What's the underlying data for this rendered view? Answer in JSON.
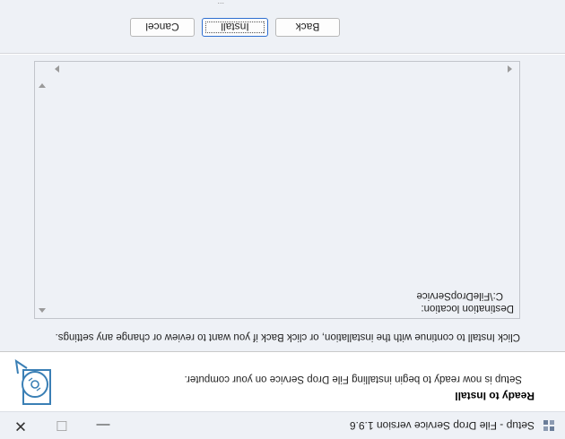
{
  "window": {
    "title": "Setup - File Drop Service version 1.9.6",
    "minimize_label": "—",
    "maximize_label": "☐",
    "close_label": "✕"
  },
  "header": {
    "title": "Ready to Install",
    "subtitle": "Setup is now ready to begin installing File Drop Service on your computer.",
    "icon": "setup-disc-icon"
  },
  "body": {
    "instruction": "Click Install to continue with the installation, or click Back if you want to review or change any settings.",
    "memo": {
      "heading": "Destination location:",
      "value": "C:\\FileDropService"
    }
  },
  "footer": {
    "back_label": "Back",
    "install_label": "Install",
    "cancel_label": "Cancel",
    "fragment": "..."
  },
  "colors": {
    "body_bg": "#eef1f6",
    "header_bg": "#ffffff",
    "focus_border": "#2f6fd0"
  }
}
